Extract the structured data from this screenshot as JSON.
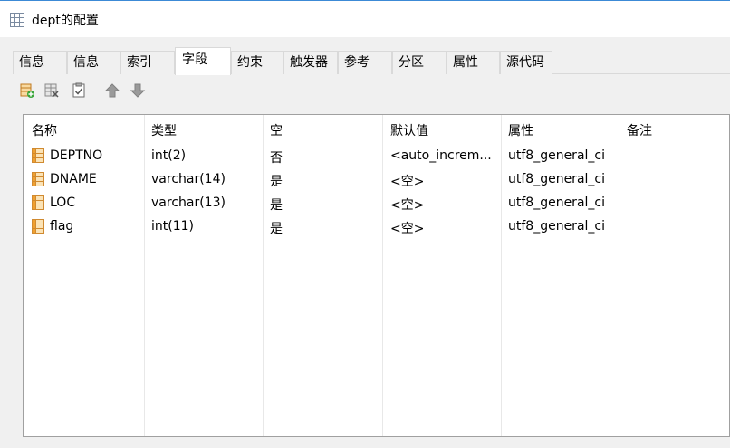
{
  "window": {
    "title": "dept的配置"
  },
  "tabs": [
    {
      "label": "信息",
      "active": false
    },
    {
      "label": "信息",
      "active": false
    },
    {
      "label": "索引",
      "active": false
    },
    {
      "label": "字段",
      "active": true
    },
    {
      "label": "约束",
      "active": false
    },
    {
      "label": "触发器",
      "active": false
    },
    {
      "label": "参考",
      "active": false
    },
    {
      "label": "分区",
      "active": false
    },
    {
      "label": "属性",
      "active": false
    },
    {
      "label": "源代码",
      "active": false
    }
  ],
  "toolbar": {
    "icons": [
      "add-field-icon",
      "delete-field-icon",
      "properties-icon",
      "move-up-icon",
      "move-down-icon"
    ]
  },
  "grid": {
    "columns": [
      "名称",
      "类型",
      "空",
      "默认值",
      "属性",
      "备注"
    ],
    "rows": [
      {
        "name": "DEPTNO",
        "type": "int(2)",
        "null": "否",
        "default": "<auto_increm...",
        "attr": "utf8_general_ci",
        "comment": ""
      },
      {
        "name": "DNAME",
        "type": "varchar(14)",
        "null": "是",
        "default": "<空>",
        "attr": "utf8_general_ci",
        "comment": ""
      },
      {
        "name": "LOC",
        "type": "varchar(13)",
        "null": "是",
        "default": "<空>",
        "attr": "utf8_general_ci",
        "comment": ""
      },
      {
        "name": "flag",
        "type": "int(11)",
        "null": "是",
        "default": "<空>",
        "attr": "utf8_general_ci",
        "comment": ""
      }
    ]
  },
  "colors": {
    "accent_border": "#3c8ad6",
    "field_icon_orange": "#f0a030",
    "add_icon_green": "#3aa53a"
  }
}
